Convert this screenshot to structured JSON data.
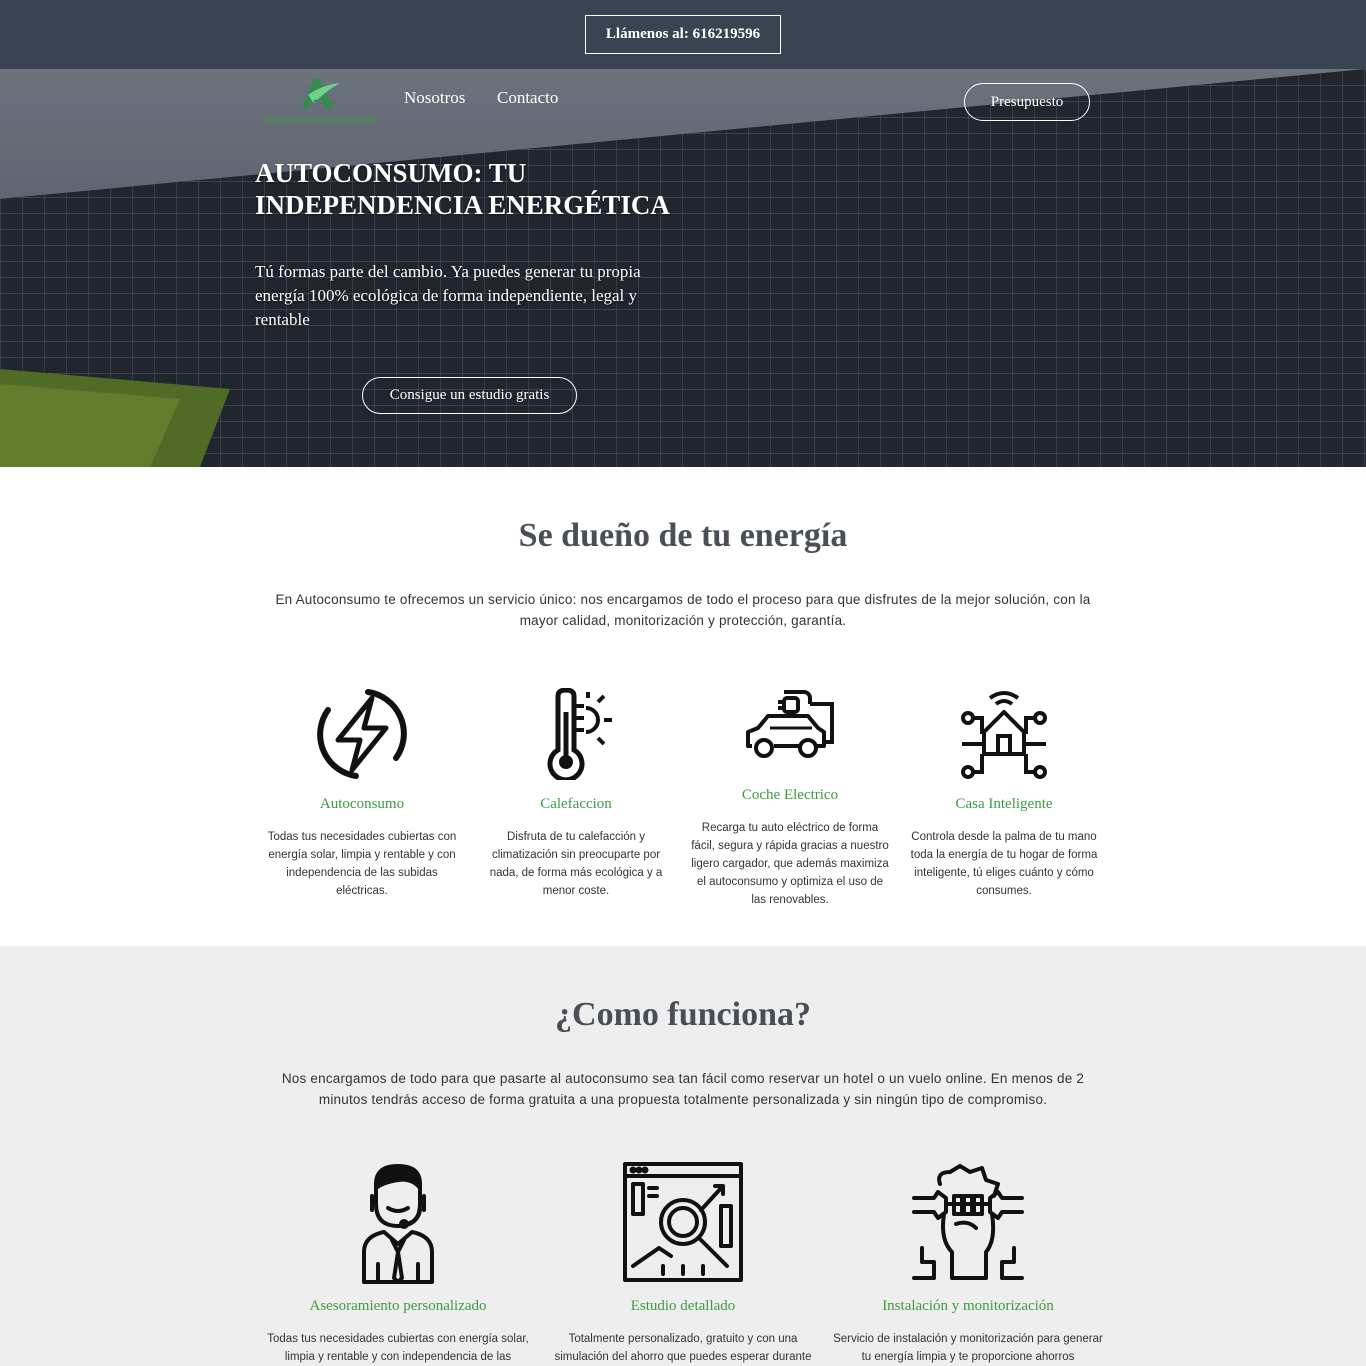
{
  "topbar": {
    "call_label": "Llámenos al: 616219596"
  },
  "nav": {
    "logo_text": "Autoconsumo",
    "items": [
      {
        "label": "Nosotros"
      },
      {
        "label": "Contacto"
      }
    ],
    "budget_label": "Presupuesto"
  },
  "hero": {
    "title": "AUTOCONSUMO: TU INDEPENDENCIA ENERGÉTICA",
    "text": "Tú formas parte del cambio. Ya puedes generar tu propia energía 100% ecológica de forma independiente, legal y rentable",
    "cta_label": "Consigue un estudio gratis"
  },
  "services": {
    "title": "Se dueño de tu energía",
    "intro": "En Autoconsumo te ofrecemos un servicio único: nos encargamos de todo el proceso para que disfrutes de la mejor solución, con la mayor calidad, monitorización y protección, garantía.",
    "items": [
      {
        "icon": "lightning-icon",
        "title": "Autoconsumo",
        "text": "Todas tus necesidades cubiertas con energía solar, limpia y rentable y con independencia de las subidas eléctricas."
      },
      {
        "icon": "thermometer-icon",
        "title": "Calefaccion",
        "text": "Disfruta de tu calefacción y climatización sin preocuparte por nada, de forma más ecológica y a menor coste."
      },
      {
        "icon": "electric-car-icon",
        "title": "Coche Electrico",
        "text": "Recarga tu auto eléctrico de forma fácil, segura y rápida gracias a nuestro ligero cargador, que además maximiza el autoconsumo y optimiza el uso de las renovables."
      },
      {
        "icon": "smart-home-icon",
        "title": "Casa Inteligente",
        "text": "Controla desde la palma de tu mano toda la energía de tu hogar de forma inteligente, tú eliges cuánto y cómo consumes."
      }
    ]
  },
  "how": {
    "title": "¿Como funciona?",
    "intro": "Nos encargamos de todo para que pasarte al autoconsumo sea tan fácil como reservar un hotel o un vuelo online. En menos de 2 minutos tendrás acceso de forma gratuita a una propuesta totalmente personalizada y sin ningún tipo de compromiso.",
    "steps": [
      {
        "icon": "advisor-icon",
        "title": "Asesoramiento personalizado",
        "text": "Todas tus necesidades cubiertas con energía solar, limpia y rentable y con independencia de las"
      },
      {
        "icon": "analysis-icon",
        "title": "Estudio detallado",
        "text": "Totalmente personalizado, gratuito y con una simulación del ahorro que puedes esperar durante"
      },
      {
        "icon": "installation-icon",
        "title": "Instalación y monitorización",
        "text": "Servicio de instalación y monitorización para generar tu energía limpia y te proporcione ahorros"
      }
    ]
  },
  "colors": {
    "topbar": "#394352",
    "accent_green": "#3d9b3f",
    "gray_section": "#eeeeee"
  }
}
